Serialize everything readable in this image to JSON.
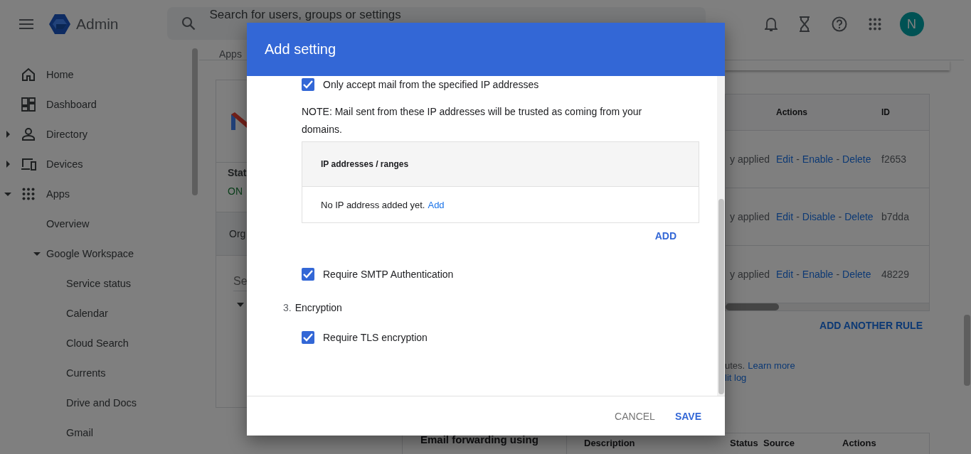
{
  "topbar": {
    "product": "Admin",
    "search": {
      "placeholder": "Search for users, groups or settings"
    },
    "avatar": "N"
  },
  "sidebar": {
    "items": [
      {
        "label": "Home"
      },
      {
        "label": "Dashboard"
      },
      {
        "label": "Directory",
        "expanded": false
      },
      {
        "label": "Devices",
        "expanded": false
      },
      {
        "label": "Apps",
        "expanded": true,
        "children": [
          {
            "label": "Overview"
          },
          {
            "label": "Google Workspace",
            "expanded": true,
            "children": [
              {
                "label": "Service status"
              },
              {
                "label": "Calendar"
              },
              {
                "label": "Cloud Search"
              },
              {
                "label": "Currents"
              },
              {
                "label": "Drive and Docs"
              },
              {
                "label": "Gmail"
              }
            ]
          }
        ]
      }
    ]
  },
  "breadcrumb": "Apps",
  "app_card": {
    "status_label": "Stat",
    "status_value": "ON",
    "org_row": "Org",
    "search": {
      "placeholder": "Se"
    }
  },
  "rules_table": {
    "columns": [
      "Actions",
      "ID"
    ],
    "rows": [
      {
        "status": "y applied",
        "actions": [
          {
            "kind": "link",
            "label": "Edit"
          },
          {
            "kind": "separator",
            "label": "-"
          },
          {
            "kind": "link",
            "label": "Enable"
          },
          {
            "kind": "separator",
            "label": "-"
          },
          {
            "kind": "link",
            "label": "Delete"
          }
        ],
        "id": "f2653"
      },
      {
        "status": "y applied",
        "actions": [
          {
            "kind": "link",
            "label": "Edit"
          },
          {
            "kind": "separator",
            "label": "-"
          },
          {
            "kind": "link",
            "label": "Disable"
          },
          {
            "kind": "separator",
            "label": "-"
          },
          {
            "kind": "link",
            "label": "Delete"
          }
        ],
        "id": "b7dda"
      },
      {
        "status": "y applied",
        "actions": [
          {
            "kind": "link",
            "label": "Edit"
          },
          {
            "kind": "separator",
            "label": "-"
          },
          {
            "kind": "link",
            "label": "Enable"
          },
          {
            "kind": "separator",
            "label": "-"
          },
          {
            "kind": "link",
            "label": "Delete"
          }
        ],
        "id": "48229"
      }
    ]
  },
  "add_rule_button": "ADD ANOTHER RULE",
  "footnote": {
    "line_1": "utes.",
    "link": "Learn more",
    "line_2": "lit log"
  },
  "forwarding_card": {
    "title": "Email forwarding using",
    "columns": [
      "Description",
      "Status",
      "Source",
      "Actions"
    ]
  },
  "dialog": {
    "title": "Add setting",
    "items": [
      {
        "kind": "checkbox",
        "label": "Only accept mail from the specified IP addresses",
        "checked": true
      },
      {
        "kind": "note",
        "text": "NOTE: Mail sent from these IP addresses will be trusted as coming from your domains."
      },
      {
        "kind": "table",
        "columns": [
          "IP addresses / ranges"
        ],
        "empty_text": "No IP address added yet.",
        "empty_link": "Add"
      },
      {
        "kind": "button",
        "label": "ADD"
      },
      {
        "kind": "checkbox",
        "label": "Require SMTP Authentication",
        "checked": true
      },
      {
        "kind": "section",
        "number": "3.",
        "label": "Encryption"
      },
      {
        "kind": "checkbox",
        "label": "Require TLS encryption",
        "checked": true
      }
    ],
    "buttons": [
      {
        "kind": "secondary",
        "label": "CANCEL"
      },
      {
        "kind": "primary",
        "label": "SAVE"
      }
    ]
  }
}
